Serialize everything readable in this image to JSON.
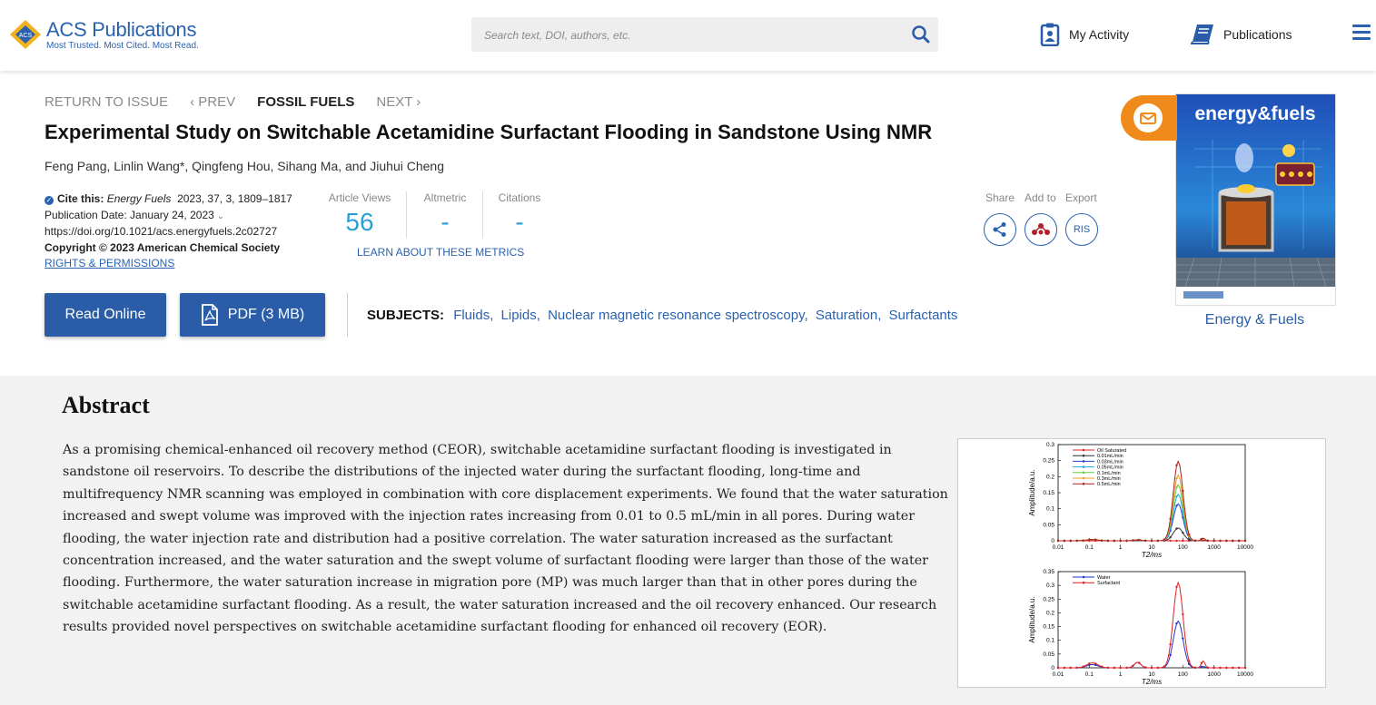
{
  "header": {
    "logo_brand": "ACS Publications",
    "logo_tagline": "Most Trusted. Most Cited. Most Read.",
    "search_placeholder": "Search text, DOI, authors, etc.",
    "my_activity": "My Activity",
    "publications": "Publications",
    "colors": {
      "brand": "#2a62b0",
      "accent": "#f08a1a"
    }
  },
  "nav": {
    "return": "RETURN TO ISSUE",
    "prev": "‹ PREV",
    "section": "FOSSIL FUELS",
    "next": "NEXT ›"
  },
  "article": {
    "title": "Experimental Study on Switchable Acetamidine Surfactant Flooding in Sandstone Using NMR",
    "authors": "Feng Pang, Linlin Wang*, Qingfeng Hou, Sihang Ma, and Jiuhui Cheng",
    "cite_label": "Cite this:",
    "cite_journal": "Energy Fuels",
    "cite_detail": "2023, 37, 3, 1809–1817",
    "pub_date": "Publication Date: January 24, 2023",
    "doi": "https://doi.org/10.1021/acs.energyfuels.2c02727",
    "copyright": "Copyright © 2023 American Chemical Society",
    "rights": "RIGHTS & PERMISSIONS"
  },
  "metrics": {
    "views_label": "Article Views",
    "views_value": "56",
    "altmetric_label": "Altmetric",
    "altmetric_value": "-",
    "citations_label": "Citations",
    "citations_value": "-",
    "learn": "LEARN ABOUT THESE METRICS"
  },
  "actions": {
    "share": "Share",
    "add_to": "Add to",
    "export": "Export",
    "ris": "RIS"
  },
  "buttons": {
    "read_online": "Read Online",
    "pdf": "PDF (3 MB)"
  },
  "subjects": {
    "label": "SUBJECTS:",
    "items": [
      "Fluids",
      "Lipids",
      "Nuclear magnetic resonance spectroscopy",
      "Saturation",
      "Surfactants"
    ]
  },
  "cover": {
    "journal_name": "energy&fuels",
    "caption": "Energy & Fuels"
  },
  "abstract": {
    "heading": "Abstract",
    "text": "As a promising chemical-enhanced oil recovery method (CEOR), switchable acetamidine surfactant flooding is investigated in sandstone oil reservoirs. To describe the distributions of the injected water during the surfactant flooding, long-time and multifrequency NMR scanning was employed in combination with core displacement experiments. We found that the water saturation increased and swept volume was improved with the injection rates increasing from 0.01 to 0.5 mL/min in all pores. During water flooding, the water injection rate and distribution had a positive correlation. The water saturation increased as the surfactant concentration increased, and the water saturation and the swept volume of surfactant flooding were larger than those of the water flooding. Furthermore, the water saturation increase in migration pore (MP) was much larger than that in other pores during the switchable acetamidine surfactant flooding. As a result, the water saturation increased and the oil recovery enhanced. Our research results provided novel perspectives on switchable acetamidine surfactant flooding for enhanced oil recovery (EOR)."
  },
  "chart_data": [
    {
      "type": "line",
      "ylabel": "Amplitude/a.u.",
      "xlabel": "T2/ms",
      "xscale": "log",
      "xlim": [
        0.01,
        10000
      ],
      "ylim": [
        0,
        0.3
      ],
      "xticks": [
        "0.01",
        "0.1",
        "1",
        "10",
        "100",
        "1000",
        "10000"
      ],
      "yticks": [
        "0",
        "0.05",
        "0.1",
        "0.15",
        "0.2",
        "0.25",
        "0.3"
      ],
      "legend_position": "top-left",
      "series": [
        {
          "name": "Oil Saturated",
          "color": "#e02020",
          "peak": 0.0
        },
        {
          "name": "0.01mL/min",
          "color": "#333333",
          "peak": 0.04
        },
        {
          "name": "0.03mL/min",
          "color": "#2244cc",
          "peak": 0.115
        },
        {
          "name": "0.05mL/min",
          "color": "#22aadd",
          "peak": 0.145
        },
        {
          "name": "0.1mL/min",
          "color": "#66cc44",
          "peak": 0.175
        },
        {
          "name": "0.3mL/min",
          "color": "#f0a020",
          "peak": 0.205
        },
        {
          "name": "0.5mL/min",
          "color": "#b02020",
          "peak": 0.248
        }
      ]
    },
    {
      "type": "line",
      "ylabel": "Amplitude/a.u.",
      "xlabel": "T2/ms",
      "xscale": "log",
      "xlim": [
        0.01,
        10000
      ],
      "ylim": [
        0,
        0.35
      ],
      "xticks": [
        "0.01",
        "0.1",
        "1",
        "10",
        "100",
        "1000",
        "10000"
      ],
      "yticks": [
        "0",
        "0.05",
        "0.1",
        "0.15",
        "0.2",
        "0.25",
        "0.3",
        "0.35"
      ],
      "legend_position": "top-left",
      "series": [
        {
          "name": "Water",
          "color": "#2233cc",
          "peak": 0.17
        },
        {
          "name": "Surfactant",
          "color": "#e02020",
          "peak": 0.31
        }
      ]
    }
  ]
}
